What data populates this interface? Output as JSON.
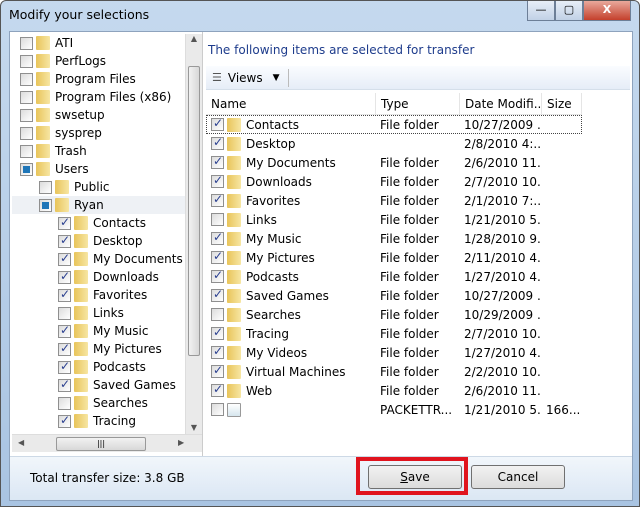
{
  "window": {
    "title": "Modify your selections",
    "minimize": "—",
    "maximize": "▢",
    "close": "X"
  },
  "tree": [
    {
      "label": "ATI",
      "level": 0,
      "state": "off"
    },
    {
      "label": "PerfLogs",
      "level": 0,
      "state": "off"
    },
    {
      "label": "Program Files",
      "level": 0,
      "state": "off"
    },
    {
      "label": "Program Files (x86)",
      "level": 0,
      "state": "off"
    },
    {
      "label": "swsetup",
      "level": 0,
      "state": "off"
    },
    {
      "label": "sysprep",
      "level": 0,
      "state": "off"
    },
    {
      "label": "Trash",
      "level": 0,
      "state": "off"
    },
    {
      "label": "Users",
      "level": 0,
      "state": "part"
    },
    {
      "label": "Public",
      "level": 1,
      "state": "off"
    },
    {
      "label": "Ryan",
      "level": 1,
      "state": "part",
      "selected": true
    },
    {
      "label": "Contacts",
      "level": 2,
      "state": "on"
    },
    {
      "label": "Desktop",
      "level": 2,
      "state": "on"
    },
    {
      "label": "My Documents",
      "level": 2,
      "state": "on"
    },
    {
      "label": "Downloads",
      "level": 2,
      "state": "on"
    },
    {
      "label": "Favorites",
      "level": 2,
      "state": "on"
    },
    {
      "label": "Links",
      "level": 2,
      "state": "off"
    },
    {
      "label": "My Music",
      "level": 2,
      "state": "on"
    },
    {
      "label": "My Pictures",
      "level": 2,
      "state": "on"
    },
    {
      "label": "Podcasts",
      "level": 2,
      "state": "on"
    },
    {
      "label": "Saved Games",
      "level": 2,
      "state": "on"
    },
    {
      "label": "Searches",
      "level": 2,
      "state": "off"
    },
    {
      "label": "Tracing",
      "level": 2,
      "state": "on"
    }
  ],
  "main": {
    "heading": "The following items are selected for transfer",
    "views_label": "Views",
    "columns": [
      "Name",
      "Type",
      "Date Modifi...",
      "Size"
    ],
    "rows": [
      {
        "name": "Contacts",
        "type": "File folder",
        "date": "10/27/2009 ...",
        "size": "",
        "checked": true
      },
      {
        "name": "Desktop",
        "type": "",
        "date": "2/8/2010 4:...",
        "size": "",
        "checked": true
      },
      {
        "name": "My Documents",
        "type": "File folder",
        "date": "2/6/2010 11...",
        "size": "",
        "checked": true
      },
      {
        "name": "Downloads",
        "type": "File folder",
        "date": "2/7/2010 10...",
        "size": "",
        "checked": true
      },
      {
        "name": "Favorites",
        "type": "File folder",
        "date": "2/1/2010 7:...",
        "size": "",
        "checked": true
      },
      {
        "name": "Links",
        "type": "File folder",
        "date": "1/21/2010 5...",
        "size": "",
        "checked": false
      },
      {
        "name": "My Music",
        "type": "File folder",
        "date": "1/28/2010 9...",
        "size": "",
        "checked": true
      },
      {
        "name": "My Pictures",
        "type": "File folder",
        "date": "2/11/2010 4...",
        "size": "",
        "checked": true
      },
      {
        "name": "Podcasts",
        "type": "File folder",
        "date": "1/27/2010 4...",
        "size": "",
        "checked": true
      },
      {
        "name": "Saved Games",
        "type": "File folder",
        "date": "10/27/2009 ...",
        "size": "",
        "checked": true
      },
      {
        "name": "Searches",
        "type": "File folder",
        "date": "10/29/2009 ...",
        "size": "",
        "checked": false
      },
      {
        "name": "Tracing",
        "type": "File folder",
        "date": "2/7/2010 10...",
        "size": "",
        "checked": true
      },
      {
        "name": "My Videos",
        "type": "File folder",
        "date": "1/27/2010 4...",
        "size": "",
        "checked": true
      },
      {
        "name": "Virtual Machines",
        "type": "File folder",
        "date": "2/2/2010 10...",
        "size": "",
        "checked": true
      },
      {
        "name": "Web",
        "type": "File folder",
        "date": "2/6/2010 11...",
        "size": "",
        "checked": true
      },
      {
        "name": "",
        "type": "PACKETTR...",
        "date": "1/21/2010 5...",
        "size": "166...",
        "checked": false,
        "file": true
      }
    ]
  },
  "footer": {
    "total": "Total transfer size: 3.8 GB",
    "save": "Save",
    "cancel": "Cancel"
  },
  "colors": {
    "highlight": "#e0141e",
    "heading": "#1e3c8c"
  }
}
